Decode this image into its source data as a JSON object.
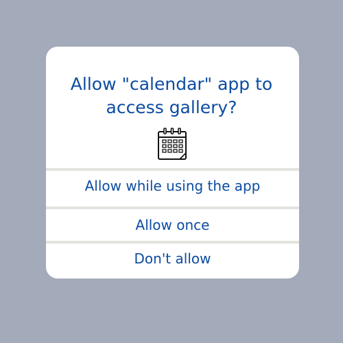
{
  "dialog": {
    "title_line1": "Allow \"calendar\" app to",
    "title_line2": "access gallery?",
    "icon": "calendar-icon",
    "options": [
      {
        "label": "Allow while using the app"
      },
      {
        "label": "Allow once"
      },
      {
        "label": "Don't allow"
      }
    ]
  },
  "colors": {
    "background": "#a3aab9",
    "dialog_background": "#ffffff",
    "text": "#0d4ca0",
    "divider": "#e3e3df"
  }
}
